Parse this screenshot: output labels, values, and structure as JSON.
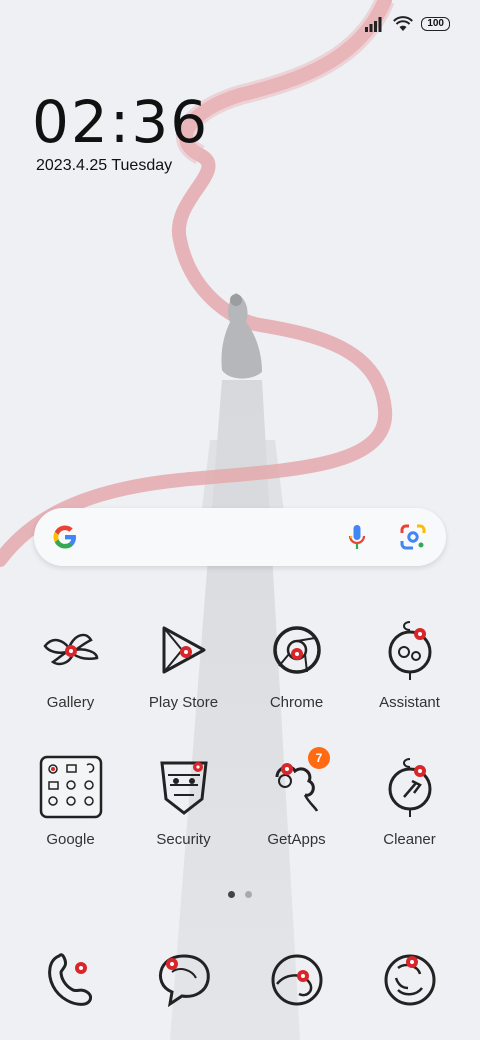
{
  "status": {
    "battery": "100"
  },
  "lockscreen": {
    "time": "02:36",
    "date": "2023.4.25 Tuesday"
  },
  "apps_row1": [
    {
      "label": "Gallery"
    },
    {
      "label": "Play Store"
    },
    {
      "label": "Chrome"
    },
    {
      "label": "Assistant"
    }
  ],
  "apps_row2": [
    {
      "label": "Google"
    },
    {
      "label": "Security"
    },
    {
      "label": "GetApps",
      "badge": "7"
    },
    {
      "label": "Cleaner"
    }
  ],
  "pages": {
    "count": 2,
    "current": 1
  },
  "dock": [
    {
      "icon": "phone-icon"
    },
    {
      "icon": "messages-icon"
    },
    {
      "icon": "browser-icon"
    },
    {
      "icon": "camera-icon"
    }
  ],
  "colors": {
    "ribbon": "#e4a9ad",
    "badge": "#ff6a13",
    "accent_red": "#d8262b"
  }
}
